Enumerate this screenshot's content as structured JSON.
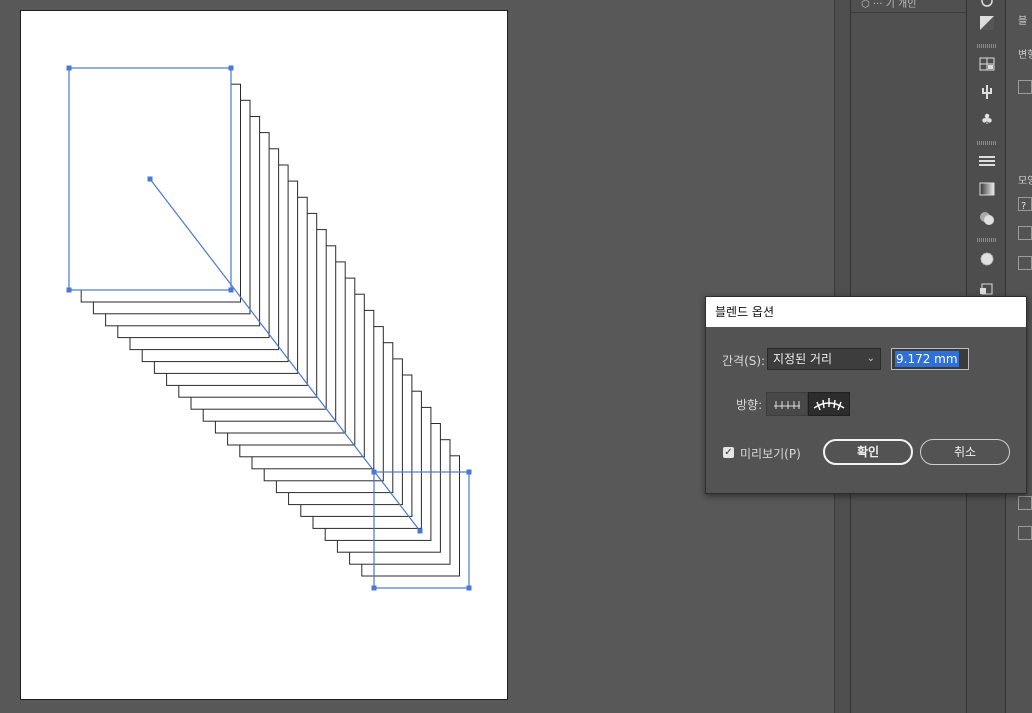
{
  "dialog": {
    "title": "블렌드 옵션",
    "spacing_label": "간격(S):",
    "spacing_select_value": "지정된 거리",
    "spacing_input_value": "9.172 mm",
    "orientation_label": "방향:",
    "preview_label": "미리보기(P)",
    "preview_checked": true,
    "ok_label": "확인",
    "cancel_label": "취소"
  },
  "panel": {
    "top_label": "⬡  ··· 기 개인",
    "side_labels": [
      "블",
      "변형",
      "모양",
      "?"
    ]
  },
  "icons": [
    "eye-icon",
    "gradient-icon",
    "grid-icon",
    "plug-icon",
    "club-symbol-icon",
    "align-lines-icon",
    "gradient-swatch-icon",
    "circles-icon",
    "sun-icon",
    "export-icon"
  ],
  "colors": {
    "selection_blue": "#4a78d6",
    "blend_stroke": "#2a2a2a",
    "canvas_bg": "#585858"
  }
}
